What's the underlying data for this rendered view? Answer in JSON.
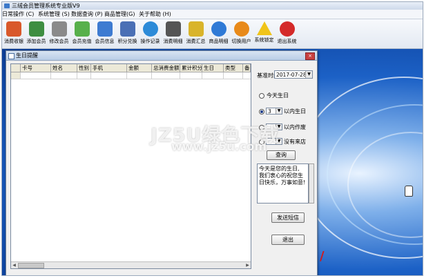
{
  "window": {
    "title": "三绒会员管理系统专业版V9"
  },
  "menu": [
    {
      "label": "日常操作 (C)"
    },
    {
      "label": "系统管理 (S)"
    },
    {
      "label": "数据查询 (P)"
    },
    {
      "label": "商品管理(G)"
    },
    {
      "label": "关于帮助 (H)"
    }
  ],
  "toolbar": [
    {
      "label": "消费收银",
      "icon": "user-cashier-icon",
      "color": "#d9592b"
    },
    {
      "label": "添加会员",
      "icon": "add-member-icon",
      "color": "#3e8e41"
    },
    {
      "label": "修改会员",
      "icon": "edit-member-icon",
      "color": "#8a8a8a"
    },
    {
      "label": "会员充值",
      "icon": "recharge-icon",
      "color": "#57b04b"
    },
    {
      "label": "会员信息",
      "icon": "member-info-icon",
      "color": "#3d7bd1"
    },
    {
      "label": "积分兑换",
      "icon": "points-exchange-icon",
      "color": "#4a6fb5"
    },
    {
      "label": "操作记录",
      "icon": "search-record-icon",
      "color": "#2d8bd8"
    },
    {
      "label": "消费明细",
      "icon": "consume-detail-icon",
      "color": "#555555"
    },
    {
      "label": "消费汇总",
      "icon": "consume-summary-icon",
      "color": "#d9b42b"
    },
    {
      "label": "商品明细",
      "icon": "goods-detail-icon",
      "color": "#2f7ad6"
    },
    {
      "label": "切换用户",
      "icon": "switch-user-icon",
      "color": "#e88a1a"
    },
    {
      "label": "系统锁定",
      "icon": "system-lock-icon",
      "color": "#f0c419"
    },
    {
      "label": "退出系统",
      "icon": "exit-icon",
      "color": "#d42a2a"
    }
  ],
  "dialog": {
    "title": "生日提醒",
    "columns": [
      "卡号",
      "姓名",
      "性别",
      "手机",
      "金额",
      "总消费金额",
      "累计积分",
      "生日",
      "类型",
      "备"
    ],
    "base_date_label": "基准时间",
    "base_date_value": "2017-07-28",
    "option_today": "今天生日",
    "option_days": "以内生日",
    "days_value": "3",
    "option_second_suffix": "以内作废",
    "option_third_suffix": "没有来店",
    "query_button": "查询",
    "message": "今天是您的生日,\n我们衷心的祝您生\n日快乐，万事如意!",
    "send_button": "发送短信",
    "exit_button": "退出"
  },
  "watermark": {
    "line1": "JZ5U绿色下载",
    "line2": "www.jz5u.com"
  }
}
